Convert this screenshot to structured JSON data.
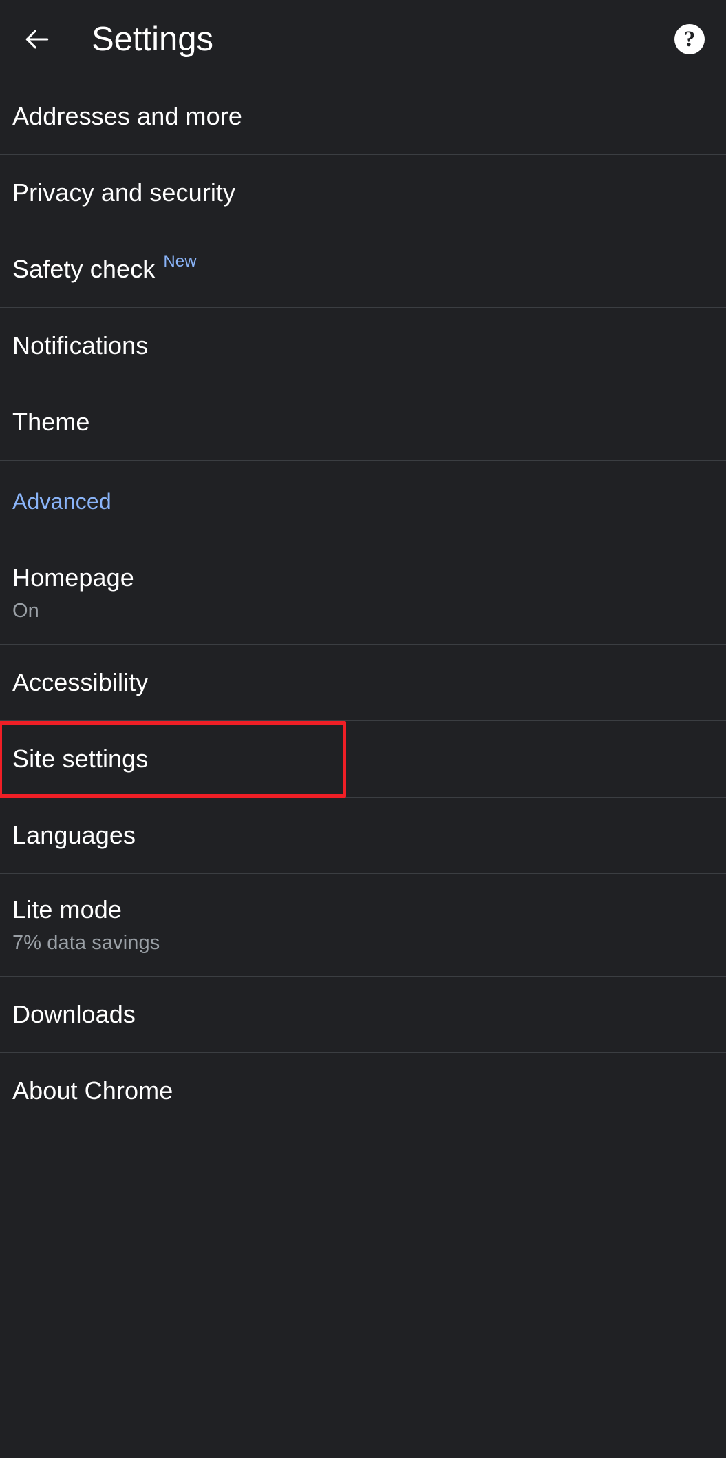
{
  "appbar": {
    "back_icon": "arrow-back-icon",
    "title": "Settings",
    "help_icon": "help-question-icon",
    "help_glyph": "?"
  },
  "colors": {
    "background": "#202124",
    "divider": "#3b3e42",
    "primary_text": "#ffffff",
    "secondary_text": "#9aa0a6",
    "accent_blue": "#8ab4f8",
    "highlight_red": "#ef1f26"
  },
  "list": {
    "items": [
      {
        "id": "addresses-and-more",
        "type": "item",
        "label": "Addresses and more",
        "subtitle": null,
        "badge": null
      },
      {
        "id": "privacy-and-security",
        "type": "item",
        "label": "Privacy and security",
        "subtitle": null,
        "badge": null
      },
      {
        "id": "safety-check",
        "type": "item",
        "label": "Safety check",
        "subtitle": null,
        "badge": "New"
      },
      {
        "id": "notifications",
        "type": "item",
        "label": "Notifications",
        "subtitle": null,
        "badge": null
      },
      {
        "id": "theme",
        "type": "item",
        "label": "Theme",
        "subtitle": null,
        "badge": null
      },
      {
        "id": "advanced",
        "type": "header",
        "label": "Advanced",
        "subtitle": null,
        "badge": null
      },
      {
        "id": "homepage",
        "type": "item",
        "label": "Homepage",
        "subtitle": "On",
        "badge": null
      },
      {
        "id": "accessibility",
        "type": "item",
        "label": "Accessibility",
        "subtitle": null,
        "badge": null
      },
      {
        "id": "site-settings",
        "type": "item",
        "label": "Site settings",
        "subtitle": null,
        "badge": null,
        "highlighted": true
      },
      {
        "id": "languages",
        "type": "item",
        "label": "Languages",
        "subtitle": null,
        "badge": null
      },
      {
        "id": "lite-mode",
        "type": "item",
        "label": "Lite mode",
        "subtitle": "7% data savings",
        "badge": null
      },
      {
        "id": "downloads",
        "type": "item",
        "label": "Downloads",
        "subtitle": null,
        "badge": null
      },
      {
        "id": "about-chrome",
        "type": "item",
        "label": "About Chrome",
        "subtitle": null,
        "badge": null
      }
    ]
  },
  "annotation": {
    "target": "site-settings",
    "shape": "rectangle",
    "color": "#ef1f26"
  }
}
